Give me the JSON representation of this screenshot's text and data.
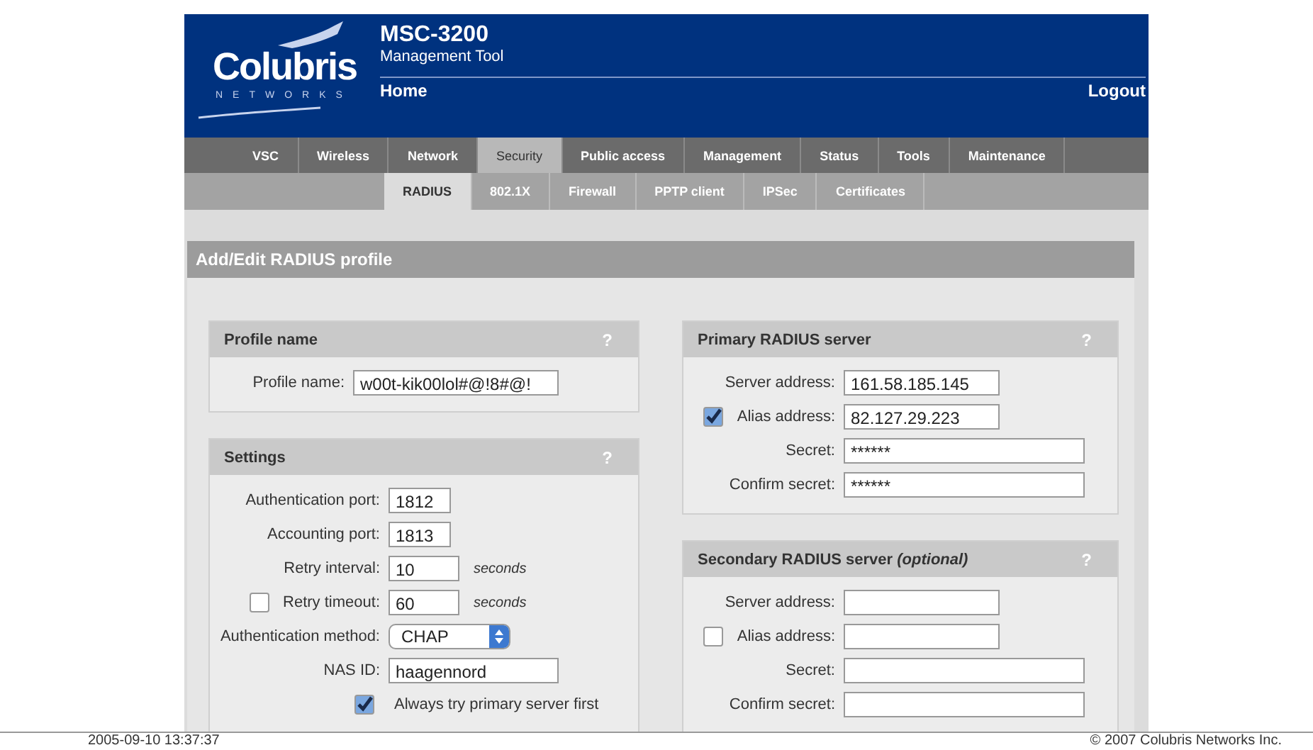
{
  "logo": {
    "name": "Colubris",
    "tagline": "NETWORKS"
  },
  "header": {
    "product": "MSC-3200",
    "subtitle": "Management Tool",
    "page": "Home",
    "logout": "Logout"
  },
  "tabs": [
    {
      "label": "VSC",
      "selected": false
    },
    {
      "label": "Wireless",
      "selected": false
    },
    {
      "label": "Network",
      "selected": false
    },
    {
      "label": "Security",
      "selected": true
    },
    {
      "label": "Public access",
      "selected": false
    },
    {
      "label": "Management",
      "selected": false
    },
    {
      "label": "Status",
      "selected": false
    },
    {
      "label": "Tools",
      "selected": false
    },
    {
      "label": "Maintenance",
      "selected": false
    }
  ],
  "subtabs": [
    {
      "label": "RADIUS",
      "selected": true
    },
    {
      "label": "802.1X",
      "selected": false
    },
    {
      "label": "Firewall",
      "selected": false
    },
    {
      "label": "PPTP client",
      "selected": false
    },
    {
      "label": "IPSec",
      "selected": false
    },
    {
      "label": "Certificates",
      "selected": false
    }
  ],
  "panel": {
    "title": "Add/Edit RADIUS profile",
    "columns": [
      [
        {
          "title": "Profile name",
          "help": "?",
          "rows": [
            {
              "kind": "text",
              "label": "Profile name:",
              "value": "w00t-kik00lol#@!8#@!"
            }
          ]
        },
        {
          "title": "Settings",
          "help": "?",
          "rows": [
            {
              "kind": "text",
              "label": "Authentication port:",
              "value": "1812"
            },
            {
              "kind": "text",
              "label": "Accounting port:",
              "value": "1813"
            },
            {
              "kind": "text",
              "label": "Retry interval:",
              "value": "10",
              "unit": "seconds"
            },
            {
              "kind": "check-text",
              "checked": false,
              "label": "Retry timeout:",
              "value": "60",
              "unit": "seconds"
            },
            {
              "kind": "select",
              "label": "Authentication method:",
              "value": "CHAP"
            },
            {
              "kind": "text",
              "label": "NAS ID:",
              "value": "haagennord"
            },
            {
              "kind": "check",
              "checked": true,
              "label": "Always try primary server first"
            }
          ]
        }
      ],
      [
        {
          "title": "Primary RADIUS server",
          "help": "?",
          "rows": [
            {
              "kind": "text",
              "label": "Server address:",
              "value": "161.58.185.145"
            },
            {
              "kind": "check-text",
              "checked": true,
              "label": "Alias address:",
              "value": "82.127.29.223"
            },
            {
              "kind": "text",
              "label": "Secret:",
              "value": "******"
            },
            {
              "kind": "text",
              "label": "Confirm secret:",
              "value": "******"
            }
          ]
        },
        {
          "title": "Secondary RADIUS server *(optional)*",
          "help": "?",
          "rows": [
            {
              "kind": "text",
              "label": "Server address:"
            },
            {
              "kind": "check-text",
              "checked": false,
              "label": "Alias address:"
            },
            {
              "kind": "text",
              "label": "Secret:"
            },
            {
              "kind": "text",
              "label": "Confirm secret:"
            }
          ]
        }
      ]
    ]
  },
  "status_bar": {
    "timestamp": "2005-09-10 13:37:37",
    "copyright": "© 2007 Colubris Networks Inc."
  }
}
